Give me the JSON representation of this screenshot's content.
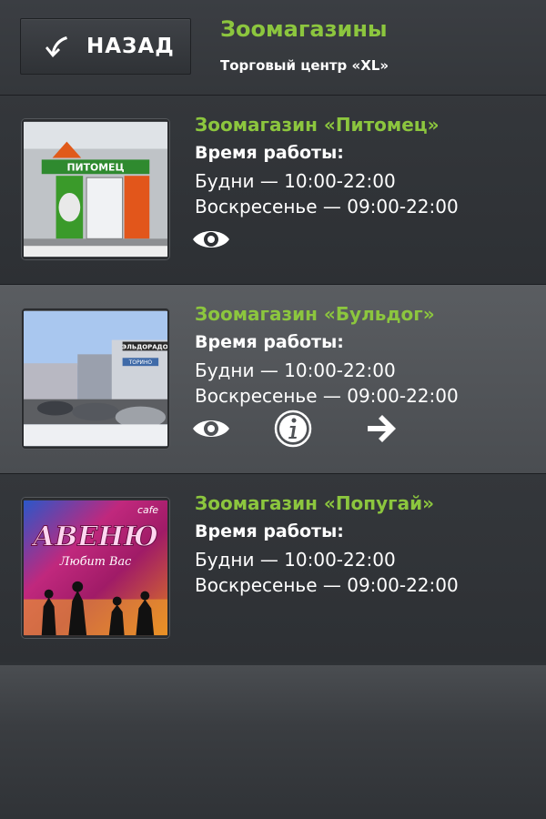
{
  "header": {
    "back_label": "НАЗАД",
    "title": "Зоомагазины",
    "subtitle": "Торговый центр «XL»"
  },
  "shops": [
    {
      "name": "Зоомагазин «Питомец»",
      "hours_title": "Время работы:",
      "weekdays": "Будни — 10:00-22:00",
      "sunday": "Воскресенье — 09:00-22:00",
      "thumb_sign": "ПИТОМЕЦ",
      "actions": [
        "eye-icon"
      ]
    },
    {
      "name": "Зоомагазин «Бульдог»",
      "hours_title": "Время работы:",
      "weekdays": "Будни — 10:00-22:00",
      "sunday": "Воскресенье — 09:00-22:00",
      "thumb_sign": "ЭЛЬДОРАДО",
      "thumb_sign2": "ТОРИНО",
      "actions": [
        "eye-icon",
        "info-icon",
        "arrow-right-icon"
      ]
    },
    {
      "name": "Зоомагазин «Попугай»",
      "hours_title": "Время работы:",
      "weekdays": "Будни — 10:00-22:00",
      "sunday": "Воскресенье — 09:00-22:00",
      "thumb_sign": "АВЕНЮ",
      "thumb_sign2": "Любит Вас",
      "thumb_sign3": "cafe",
      "actions": []
    }
  ],
  "colors": {
    "accent": "#8cc63e",
    "text": "#ffffff"
  }
}
